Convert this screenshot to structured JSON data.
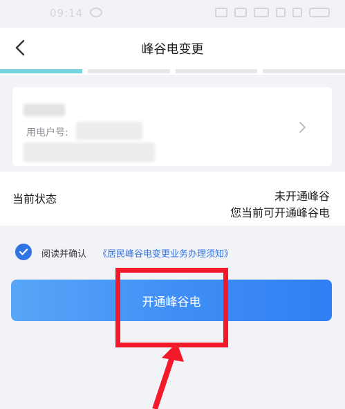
{
  "status_bar": {
    "time": "09:14"
  },
  "nav": {
    "title": "峰谷电变更"
  },
  "progress": {
    "steps": 4,
    "active_step": 1
  },
  "account": {
    "number_label": "用电户号:"
  },
  "current_status": {
    "label": "当前状态",
    "value_line1": "未开通峰谷",
    "value_line2": "您当前可开通峰谷电"
  },
  "agreement": {
    "checked": true,
    "prefix": "阅读并确认",
    "link_text": "《居民峰谷电变更业务办理须知》"
  },
  "primary_button": {
    "label": "开通峰谷电"
  },
  "colors": {
    "accent": "#2f73e5",
    "progress_active": "#74d3dc",
    "annotation": "#f2192a"
  }
}
